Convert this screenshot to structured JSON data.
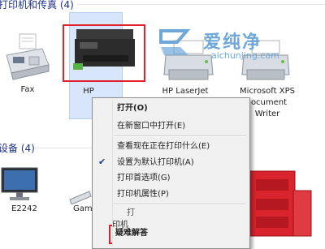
{
  "groups": {
    "printers_header": "打印机和传真 (4)",
    "devices_header": "设备 (4)"
  },
  "printers": [
    {
      "label": "Fax"
    },
    {
      "label": "HP"
    },
    {
      "label": "HP LaserJet"
    },
    {
      "label": "Microsoft XPS"
    }
  ],
  "xps_extra": [
    "ocument",
    "Writer"
  ],
  "devices": [
    {
      "label": "E2242"
    },
    {
      "label": "Gam"
    }
  ],
  "partial_text": {
    "hp_under_menu": "打",
    "print_fragment": "印机"
  },
  "context_menu": {
    "open": "打开(O)",
    "open_new_window": "在新窗口中打开(E)",
    "see_printing": "查看现在正在打印什么(E)",
    "set_default": "设置为默认打印机(A)",
    "print_prefs": "打印首选项(G)",
    "printer_props": "打印机属性(P)",
    "troubleshoot": "疑难解答"
  },
  "watermark": {
    "text": "爱纯净",
    "url": "aichunjing.com"
  },
  "colors": {
    "selection": "#d7e6fb",
    "highlight_box": "#e0202a",
    "header_text": "#1e3287"
  }
}
